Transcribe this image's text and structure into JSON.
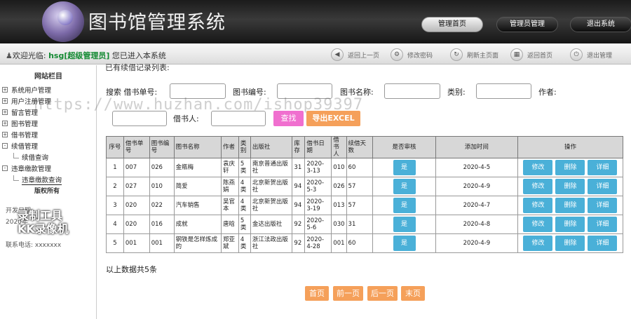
{
  "header": {
    "title": "图书馆管理系统",
    "buttons": [
      "管理首页",
      "管理员管理",
      "退出系统"
    ],
    "active_index": 0
  },
  "welcome": {
    "prefix": "欢迎光临:",
    "user": "hsg[超级管理员]",
    "suffix": "您已进入本系统"
  },
  "toolbar": [
    {
      "label": "返回上一页",
      "icon": "back-icon",
      "glyph": "◀"
    },
    {
      "label": "修改密码",
      "icon": "gear-icon",
      "glyph": "⚙"
    },
    {
      "label": "刷新主页面",
      "icon": "refresh-icon",
      "glyph": "↻"
    },
    {
      "label": "返回首页",
      "icon": "home-icon",
      "glyph": "▦"
    },
    {
      "label": "退出管理",
      "icon": "power-icon",
      "glyph": "⏻"
    }
  ],
  "sidebar": {
    "title": "网站栏目",
    "items": [
      {
        "label": "系统用户管理",
        "kind": "parent",
        "mark": "+"
      },
      {
        "label": "用户注册管理",
        "kind": "parent",
        "mark": "+"
      },
      {
        "label": "留言管理",
        "kind": "parent",
        "mark": "+"
      },
      {
        "label": "图书管理",
        "kind": "parent",
        "mark": "+"
      },
      {
        "label": "借书管理",
        "kind": "parent",
        "mark": "+"
      },
      {
        "label": "续借管理",
        "kind": "parent",
        "mark": "-"
      },
      {
        "label": "续借查询",
        "kind": "child"
      },
      {
        "label": "违章缴款管理",
        "kind": "parent",
        "mark": "-"
      },
      {
        "label": "违章缴款查询",
        "kind": "child",
        "selected": true
      }
    ],
    "copyright": "版权所有",
    "dev_date": "开发日期:",
    "dev_year": "2020年",
    "phone": "联系电话: xxxxxxx",
    "overlay": [
      "录制工具",
      "KK录像机"
    ]
  },
  "main": {
    "cut_title": "已有续借记录列表:",
    "search": {
      "prefix": "搜索",
      "borrow_no_label": "借书单号:",
      "book_no_label": "图书编号:",
      "book_name_label": "图书名称:",
      "category_label": "类别:",
      "author_label": "作者:",
      "borrower_label": "借书人:",
      "find_button": "查找",
      "excel_button": "导出EXCEL"
    },
    "table": {
      "headers": [
        "序号",
        "借书单号",
        "图书编号",
        "图书名称",
        "作者",
        "类别",
        "出版社",
        "库存",
        "借书日期",
        "借书人",
        "续借天数",
        "是否审核",
        "添加时间",
        "操作"
      ],
      "rows": [
        [
          "1",
          "007",
          "026",
          "金瓶梅",
          "袁庆轩",
          "5类",
          "南京普通出版社",
          "31",
          "2020-3-13",
          "010",
          "60",
          "是",
          "2020-4-5"
        ],
        [
          "2",
          "027",
          "010",
          "简爱",
          "陈燕娟",
          "4类",
          "北京新贺出版社",
          "94",
          "2020-5-3",
          "026",
          "57",
          "是",
          "2020-4-9"
        ],
        [
          "3",
          "020",
          "022",
          "汽车销售",
          "吴官本",
          "4类",
          "北京新贺出版社",
          "94",
          "2020-3-19",
          "013",
          "57",
          "是",
          "2020-4-7"
        ],
        [
          "4",
          "020",
          "016",
          "成就",
          "唐晗",
          "5类",
          "金达出版社",
          "92",
          "2020-5-6",
          "030",
          "31",
          "是",
          "2020-4-8"
        ],
        [
          "5",
          "001",
          "001",
          "钢铁是怎样炼成的",
          "郑亚斌",
          "4类",
          "浙江法政出版社",
          "92",
          "2020-4-28",
          "001",
          "60",
          "是",
          "2020-4-9"
        ]
      ],
      "actions": [
        "修改",
        "删除",
        "详细"
      ]
    },
    "total": "以上数据共5条",
    "pager": [
      "首页",
      "前一页",
      "后一页",
      "末页"
    ]
  },
  "watermark": "https://www.huzhan.com/ishop39397"
}
